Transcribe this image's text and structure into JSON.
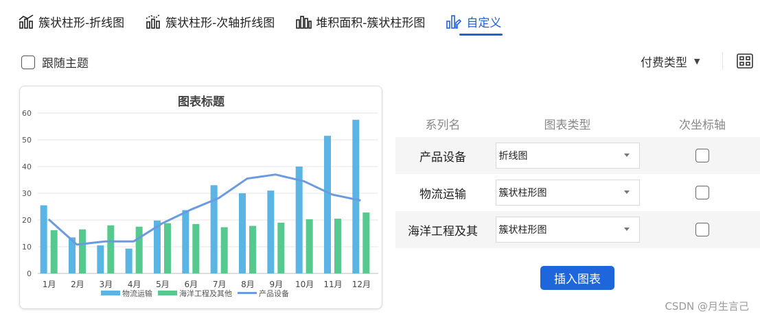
{
  "tabs": [
    {
      "label": "簇状柱形-折线图",
      "icon": "combo-chart-icon"
    },
    {
      "label": "簇状柱形-次轴折线图",
      "icon": "secondary-axis-combo-icon"
    },
    {
      "label": "堆积面积-簇状柱形图",
      "icon": "stacked-area-column-icon"
    },
    {
      "label": "自定义",
      "icon": "custom-chart-icon"
    }
  ],
  "options": {
    "follow_theme": "跟随主题",
    "pay_type": "付费类型"
  },
  "table": {
    "headers": [
      "系列名",
      "图表类型",
      "次坐标轴"
    ],
    "rows": [
      {
        "name": "产品设备",
        "type": "折线图"
      },
      {
        "name": "物流运输",
        "type": "簇状柱形图"
      },
      {
        "name": "海洋工程及其",
        "type": "簇状柱形图"
      }
    ]
  },
  "insert_label": "插入图表",
  "watermark": "CSDN @月生言己",
  "colors": {
    "accent": "#1e63d3",
    "bar1": "#5ab5e4",
    "bar2": "#55c98e",
    "line": "#6a9ae0"
  },
  "chart_data": {
    "type": "bar",
    "title": "图表标题",
    "categories": [
      "1月",
      "2月",
      "3月",
      "4月",
      "5月",
      "6月",
      "7月",
      "8月",
      "9月",
      "10月",
      "11月",
      "12月"
    ],
    "series": [
      {
        "name": "物流运输",
        "type": "bar",
        "values": [
          25.5,
          13.5,
          10.5,
          9.3,
          19.8,
          23.7,
          33.0,
          30.0,
          31.0,
          40.0,
          51.5,
          57.5
        ]
      },
      {
        "name": "海洋工程及其他",
        "type": "bar",
        "values": [
          16.2,
          16.5,
          18.0,
          17.5,
          18.8,
          18.5,
          17.3,
          17.8,
          19.0,
          20.3,
          20.5,
          22.8
        ]
      },
      {
        "name": "产品设备",
        "type": "line",
        "values": [
          20.3,
          10.8,
          12.0,
          12.0,
          18.7,
          23.8,
          28.2,
          35.5,
          37.0,
          34.5,
          29.5,
          27.3
        ]
      }
    ],
    "yticks": [
      0,
      10,
      20,
      30,
      40,
      50,
      60
    ],
    "ylim": [
      0,
      60
    ],
    "grid": true,
    "legend": "bottom"
  }
}
